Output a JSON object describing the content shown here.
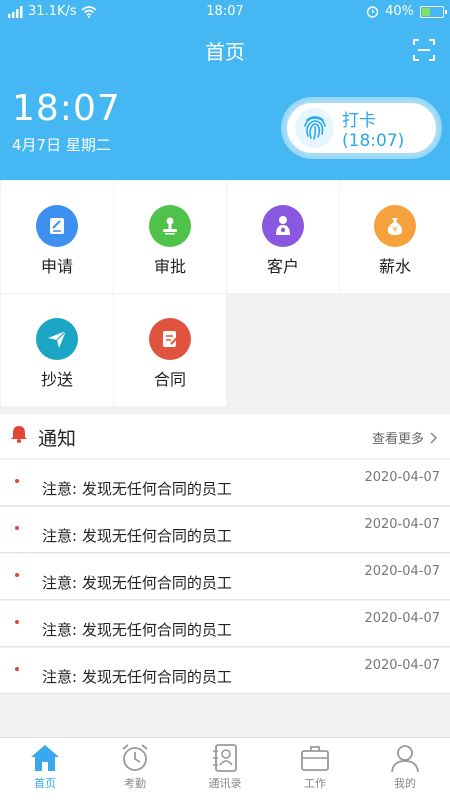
{
  "status_bar": {
    "signal": "31.1K/s",
    "time": "18:07",
    "battery": "40%"
  },
  "header": {
    "title": "首页"
  },
  "clock": {
    "time": "18:07",
    "date": "4月7日 星期二"
  },
  "punch": {
    "label": "打卡(18:07)"
  },
  "menu": [
    {
      "label": "申请",
      "color": "#3d8ff0"
    },
    {
      "label": "审批",
      "color": "#4fc24a"
    },
    {
      "label": "客户",
      "color": "#8a57e0"
    },
    {
      "label": "薪水",
      "color": "#f5a23c"
    },
    {
      "label": "抄送",
      "color": "#1aa6c4"
    },
    {
      "label": "合同",
      "color": "#e0533f"
    }
  ],
  "notice": {
    "title": "通知",
    "more": "查看更多",
    "items": [
      {
        "text": "注意: 发现无任何合同的员工",
        "time": "2020-04-07"
      },
      {
        "text": "注意: 发现无任何合同的员工",
        "time": "2020-04-07"
      },
      {
        "text": "注意: 发现无任何合同的员工",
        "time": "2020-04-07"
      },
      {
        "text": "注意: 发现无任何合同的员工",
        "time": "2020-04-07"
      },
      {
        "text": "注意: 发现无任何合同的员工",
        "time": "2020-04-07"
      }
    ]
  },
  "nav": [
    {
      "label": "首页",
      "active": true
    },
    {
      "label": "考勤",
      "active": false
    },
    {
      "label": "通讯录",
      "active": false
    },
    {
      "label": "工作",
      "active": false
    },
    {
      "label": "我的",
      "active": false
    }
  ]
}
